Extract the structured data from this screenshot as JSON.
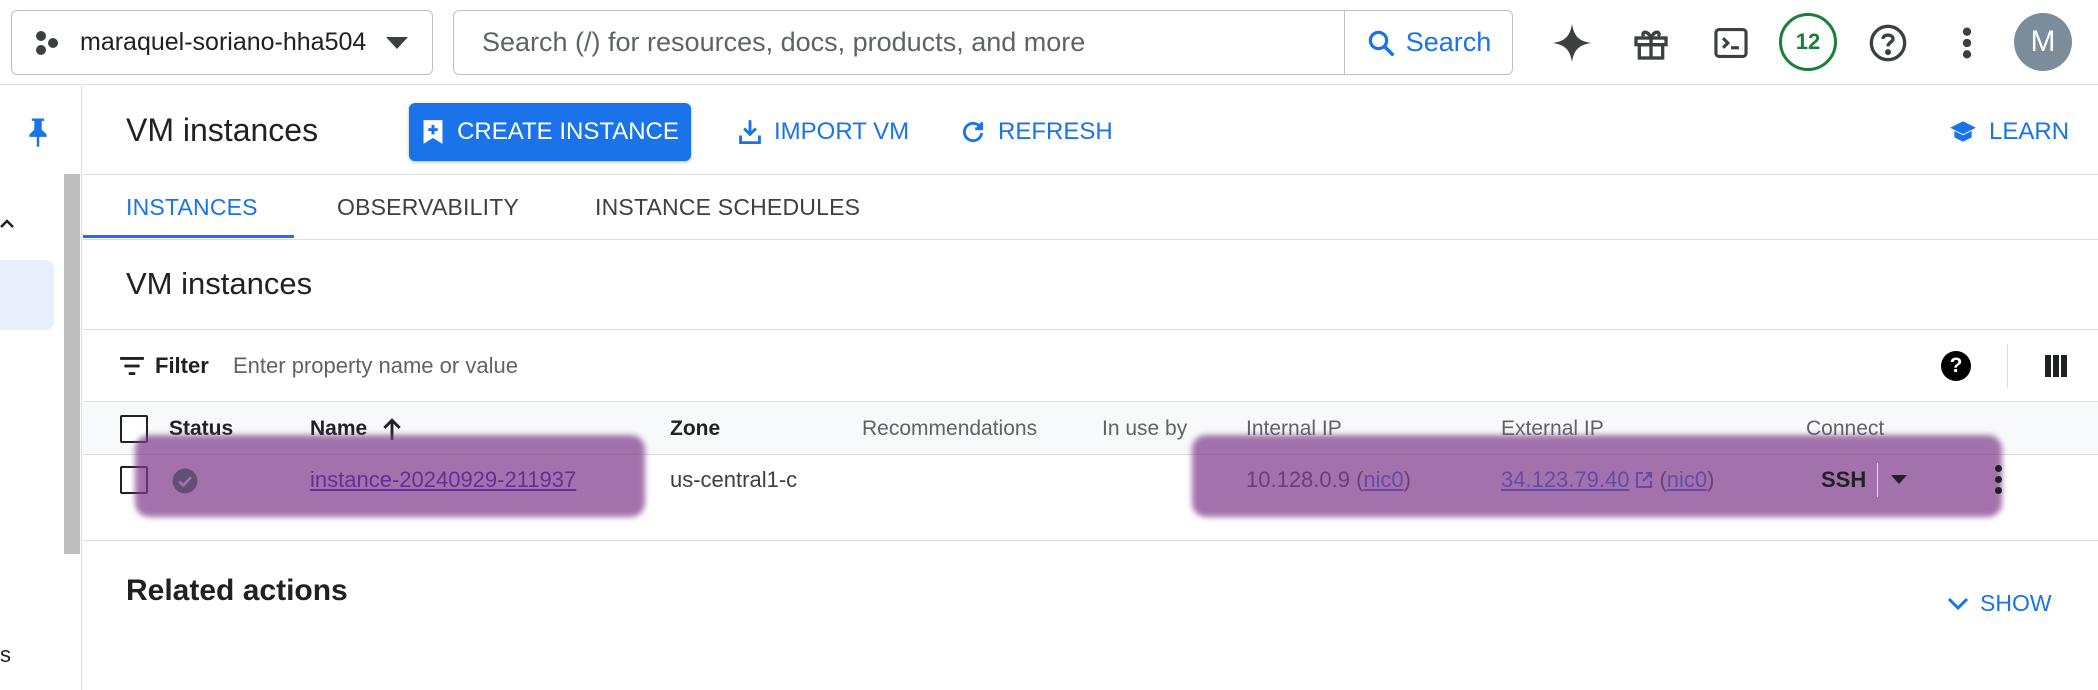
{
  "topbar": {
    "project_name": "maraquel-soriano-hha504",
    "search_placeholder": "Search (/) for resources, docs, products, and more",
    "search_button": "Search",
    "notifications_count": "12",
    "avatar_initial": "M"
  },
  "header": {
    "title": "VM instances",
    "create_instance": "CREATE INSTANCE",
    "import_vm": "IMPORT VM",
    "refresh": "REFRESH",
    "learn": "LEARN"
  },
  "tabs": [
    {
      "label": "INSTANCES",
      "active": true
    },
    {
      "label": "OBSERVABILITY",
      "active": false
    },
    {
      "label": "INSTANCE SCHEDULES",
      "active": false
    }
  ],
  "section_title": "VM instances",
  "filter": {
    "label": "Filter",
    "placeholder": "Enter property name or value"
  },
  "table": {
    "columns": [
      "Status",
      "Name",
      "Zone",
      "Recommendations",
      "In use by",
      "Internal IP",
      "External IP",
      "Connect"
    ],
    "rows": [
      {
        "status": "running",
        "name": "instance-20240929-211937",
        "zone": "us-central1-c",
        "recommendations": "",
        "in_use_by": "",
        "internal_ip": "10.128.0.9",
        "internal_nic": "nic0",
        "external_ip": "34.123.79.40",
        "external_nic": "nic0",
        "connect": "SSH"
      }
    ]
  },
  "related": {
    "title": "Related actions",
    "show": "SHOW"
  },
  "left_rail": {
    "partial_text": "s"
  },
  "colors": {
    "primary": "#1a73e8",
    "status_green": "#188038",
    "redaction": "#803c8c"
  }
}
